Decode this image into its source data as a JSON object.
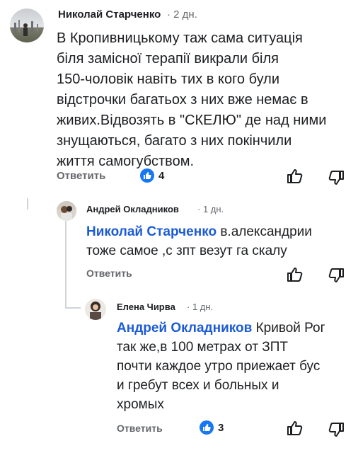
{
  "comments": [
    {
      "author": "Николай Старченко",
      "time": "2 дн.",
      "text_lines": [
        "В Кропивницькому таж сама ситуація",
        "біля замісної терапії викрали біля",
        "150-чоловік навіть тих в кого були",
        "відстрочки багатьох з них вже немає в",
        "живих.Відвозять в \"СКЕЛЮ\" де над ними",
        "знущаються, багато з них покінчили",
        "життя самогубством."
      ],
      "reply_label": "Ответить",
      "like_count": "4",
      "avatar_icon": "user-photo-avatar"
    },
    {
      "author": "Андрей Окладников",
      "time": "1 дн.",
      "mention": "Николай Старченко",
      "text_first": " в.александрии",
      "text_lines": [
        "тоже самое ,с зпт везут га скалу"
      ],
      "reply_label": "Ответить",
      "avatar_icon": "user-photo-avatar"
    },
    {
      "author": "Елена Чирва",
      "time": "1 дн.",
      "mention": "Андрей Окладников",
      "text_first": " Кривой Рог",
      "text_lines": [
        "так же,в 100 метрах от ЗПТ",
        "почти каждое утро приежает бус",
        "и гребут всех и больных и",
        "хромых"
      ],
      "reply_label": "Ответить",
      "like_count": "3",
      "avatar_icon": "user-photo-avatar"
    }
  ],
  "separator": "·",
  "icons": {
    "like": "thumbs-up-icon",
    "dislike": "thumbs-down-icon",
    "like_badge": "blue-like-badge-icon"
  },
  "colors": {
    "mention": "#1b5bd6",
    "like_badge": "#1877f2",
    "meta": "#65676b"
  }
}
